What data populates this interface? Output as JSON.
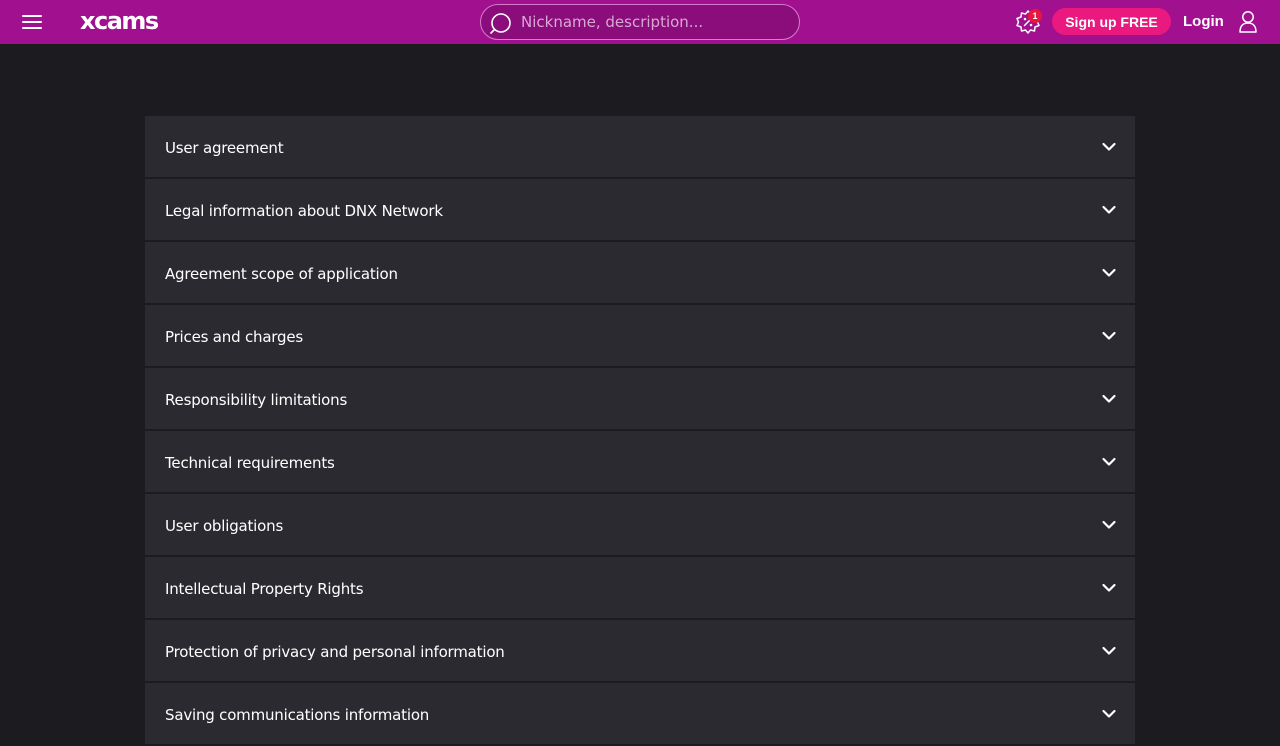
{
  "header": {
    "logo": "xcams",
    "search_placeholder": "Nickname, description...",
    "promo_badge_count": "1",
    "signup_label": "Sign up FREE",
    "login_label": "Login",
    "icons": [
      "menu-icon",
      "search-icon",
      "promo-gift-icon",
      "user-icon"
    ],
    "brand_color": "#a0108f",
    "signup_color": "#e9197f"
  },
  "accordion": {
    "items": [
      {
        "label": "User agreement"
      },
      {
        "label": "Legal information about DNX Network"
      },
      {
        "label": "Agreement scope of application"
      },
      {
        "label": "Prices and charges"
      },
      {
        "label": "Responsibility limitations"
      },
      {
        "label": "Technical requirements"
      },
      {
        "label": "User obligations"
      },
      {
        "label": "Intellectual Property Rights"
      },
      {
        "label": "Protection of privacy and personal information"
      },
      {
        "label": "Saving communications information"
      }
    ],
    "item_icon": "chevron-down-icon"
  }
}
